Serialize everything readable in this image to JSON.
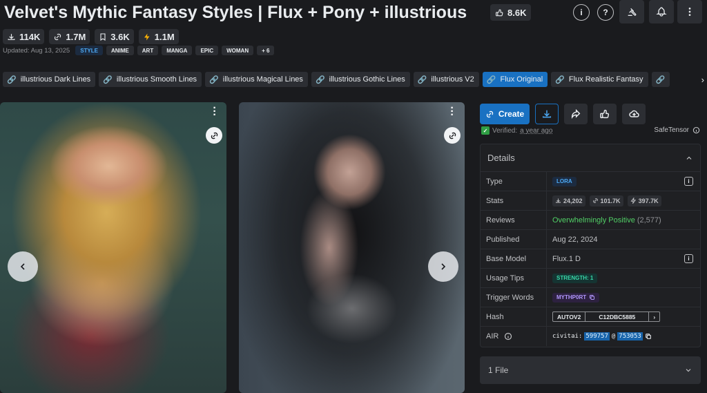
{
  "header": {
    "title": "Velvet's Mythic Fantasy Styles | Flux + Pony + illustrious",
    "likes": "8.6K",
    "info_icon": "info-icon",
    "help_icon": "question-icon",
    "buttons": [
      "gavel-icon",
      "bell-plus-icon",
      "more-vertical-icon"
    ]
  },
  "stats": {
    "downloads": "114K",
    "generations": "1.7M",
    "bookmarks": "3.6K",
    "buzz": "1.1M"
  },
  "meta": {
    "updated": "Updated: Aug 13, 2025",
    "tags": [
      "STYLE",
      "ANIME",
      "ART",
      "MANGA",
      "EPIC",
      "WOMAN",
      "+ 6"
    ]
  },
  "versions": {
    "tabs": [
      "illustrious Dark Lines",
      "illustrious Smooth Lines",
      "illustrious Magical Lines",
      "illustrious Gothic Lines",
      "illustrious V2",
      "Flux Original",
      "Flux Realistic Fantasy"
    ],
    "active_index": 5
  },
  "actions": {
    "create": "Create",
    "verified_label": "Verified:",
    "verified_ago": "a year ago",
    "safetensor": "SafeTensor"
  },
  "details": {
    "title": "Details",
    "type_label": "Type",
    "type_value": "LORA",
    "stats_label": "Stats",
    "stats_downloads": "24,202",
    "stats_generations": "101.7K",
    "stats_buzz": "397.7K",
    "reviews_label": "Reviews",
    "reviews_value": "Overwhelmingly Positive",
    "reviews_count": "(2,577)",
    "published_label": "Published",
    "published_value": "Aug 22, 2024",
    "base_label": "Base Model",
    "base_value": "Flux.1 D",
    "tips_label": "Usage Tips",
    "tips_value": "STRENGTH: 1",
    "trigger_label": "Trigger Words",
    "trigger_value": "MYTHP0RT",
    "hash_label": "Hash",
    "hash_type": "AUTOV2",
    "hash_value": "C12DBC5885",
    "air_label": "AIR",
    "air_prefix": "civitai:",
    "air_model": "599757",
    "air_at": "@",
    "air_version": "753053"
  },
  "files": {
    "label": "1 File"
  },
  "colors": {
    "accent": "#1971c2",
    "positive": "#51cf66",
    "background": "#1a1b1e"
  }
}
